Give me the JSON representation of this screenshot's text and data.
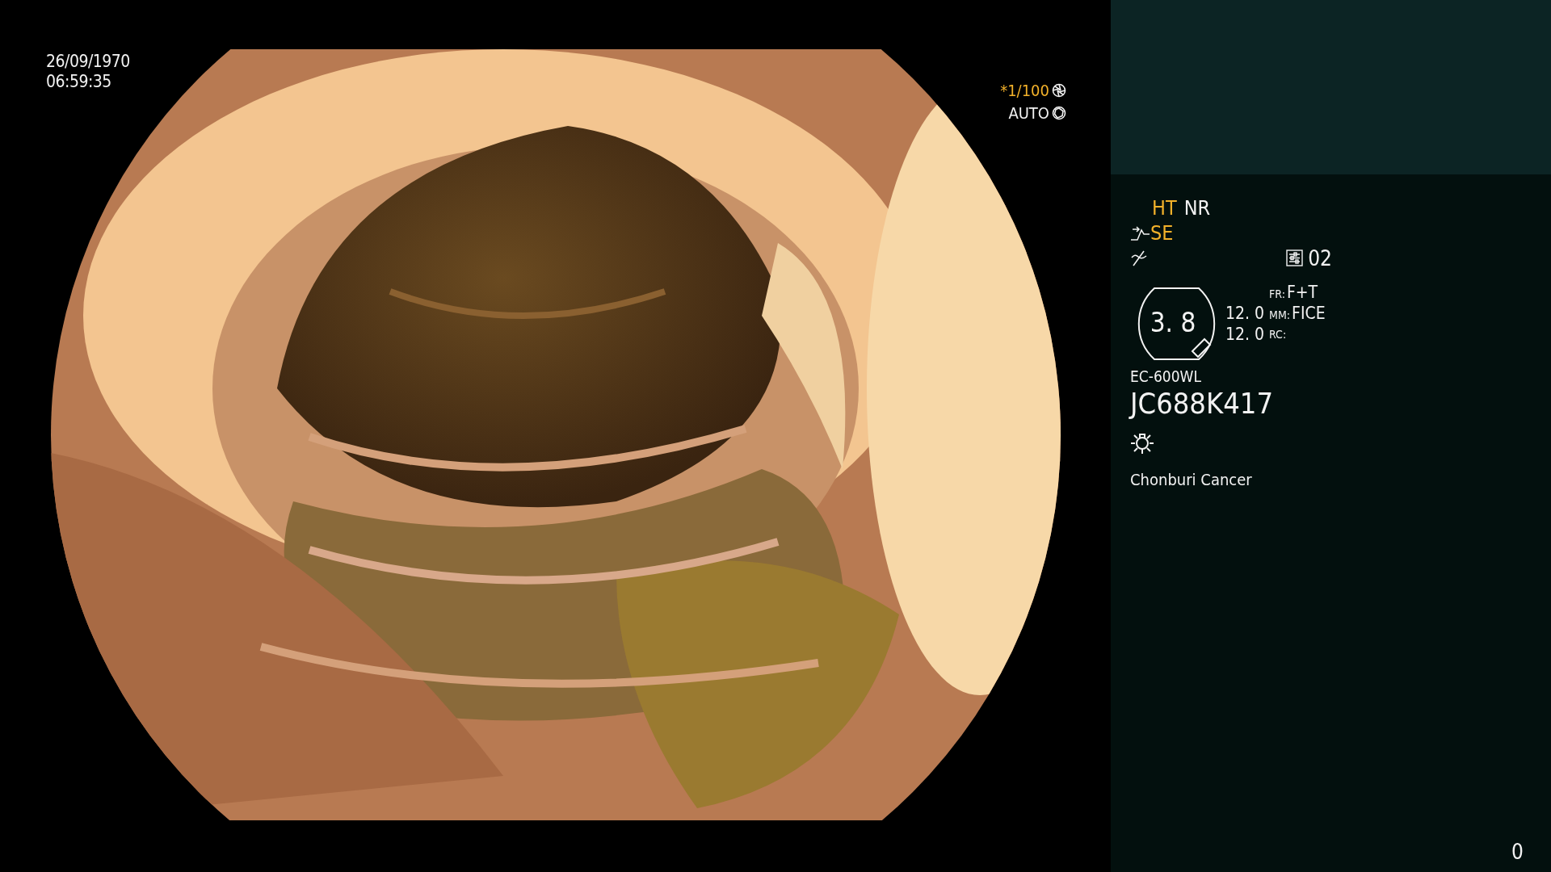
{
  "timestamp": {
    "date": "26/09/1970",
    "time": "06:59:35"
  },
  "exposure": {
    "shutter": "*1/100",
    "iris": "AUTO"
  },
  "panel": {
    "modes": [
      {
        "label": "HT",
        "active": true
      },
      {
        "label": "NR",
        "active": false
      }
    ],
    "enhance": {
      "label": "SE",
      "active": true
    },
    "preset": "02",
    "zoom": "3. 8",
    "readings": [
      "12. 0",
      "12. 0"
    ],
    "settings": [
      {
        "key": "FR:",
        "value": "F+T"
      },
      {
        "key": "MM:",
        "value": "FICE"
      },
      {
        "key": "RC:"
      }
    ],
    "scope_model": "EC-600WL",
    "serial": "JC688K417",
    "institution": "Chonburi Cancer"
  },
  "counter": "0"
}
